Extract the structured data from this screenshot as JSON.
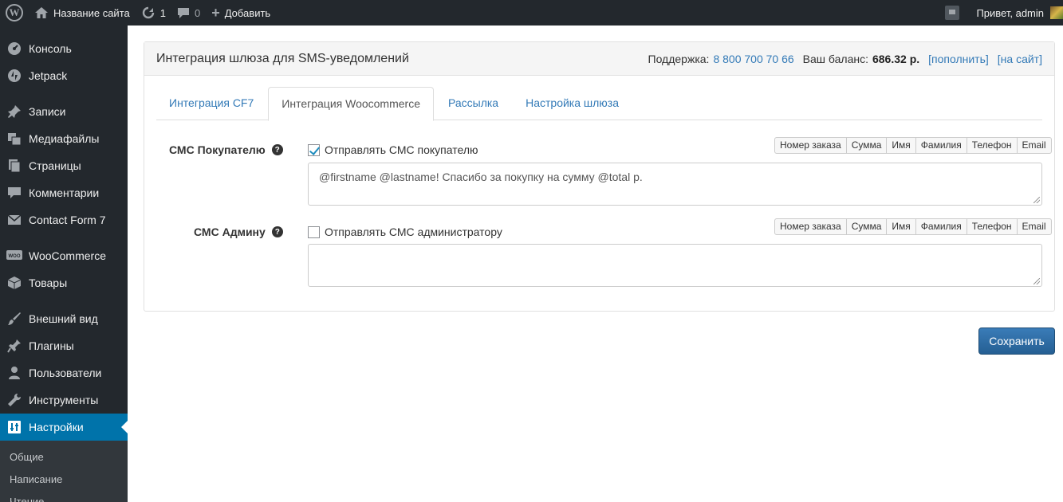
{
  "adminbar": {
    "site_name": "Название сайта",
    "updates_count": "1",
    "comments_count": "0",
    "add_new": "Добавить",
    "greeting": "Привет, admin"
  },
  "sidebar": {
    "items": [
      {
        "label": "Консоль",
        "icon": "dashboard-icon"
      },
      {
        "label": "Jetpack",
        "icon": "jetpack-icon"
      },
      {
        "label": "Записи",
        "icon": "pin-icon"
      },
      {
        "label": "Медиафайлы",
        "icon": "media-icon"
      },
      {
        "label": "Страницы",
        "icon": "pages-icon"
      },
      {
        "label": "Комментарии",
        "icon": "comment-icon"
      },
      {
        "label": "Contact Form 7",
        "icon": "mail-icon"
      },
      {
        "label": "WooCommerce",
        "icon": "woo-icon"
      },
      {
        "label": "Товары",
        "icon": "box-icon"
      },
      {
        "label": "Внешний вид",
        "icon": "brush-icon"
      },
      {
        "label": "Плагины",
        "icon": "plugin-icon"
      },
      {
        "label": "Пользователи",
        "icon": "user-icon"
      },
      {
        "label": "Инструменты",
        "icon": "wrench-icon"
      },
      {
        "label": "Настройки",
        "icon": "settings-icon"
      }
    ],
    "submenu": [
      "Общие",
      "Написание",
      "Чтение"
    ]
  },
  "panel": {
    "title": "Интеграция шлюза для SMS-уведомлений",
    "support_label": "Поддержка:",
    "support_phone": "8 800 700 70 66",
    "balance_label": "Ваш баланс:",
    "balance_value": "686.32 р.",
    "topup_link": "[пополнить]",
    "site_link": "[на сайт]"
  },
  "tabs": [
    "Интеграция CF7",
    "Интеграция Woocommerce",
    "Рассылка",
    "Настройка шлюза"
  ],
  "active_tab": "Интеграция Woocommerce",
  "rows": [
    {
      "label": "СМС Покупателю",
      "checkbox_label": "Отправлять СМС покупателю",
      "checked": true,
      "message": "@firstname @lastname! Спасибо за покупку на сумму @total р."
    },
    {
      "label": "СМС Админу",
      "checkbox_label": "Отправлять СМС администратору",
      "checked": false,
      "message": ""
    }
  ],
  "variables": [
    "Номер заказа",
    "Сумма",
    "Имя",
    "Фамилия",
    "Телефон",
    "Email"
  ],
  "save_label": "Сохранить",
  "colors": {
    "adminbar": "#23282d",
    "active_menu": "#0073aa",
    "link": "#337ab7",
    "primary_button": "#2e6da4"
  }
}
